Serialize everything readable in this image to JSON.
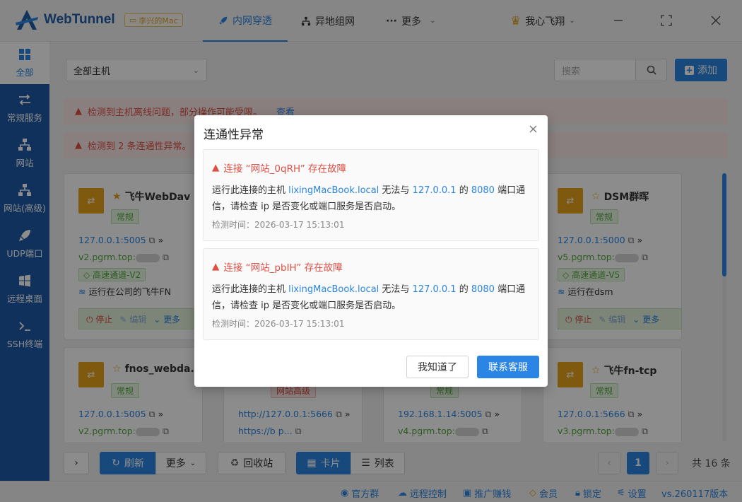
{
  "app": {
    "name": "WebTunnel",
    "device_badge": "李兴的Mac"
  },
  "nav": {
    "items": [
      {
        "label": "内网穿透",
        "active": true
      },
      {
        "label": "异地组网",
        "active": false
      },
      {
        "label": "更多",
        "active": false
      }
    ],
    "user": "我心飞翔"
  },
  "sidebar": {
    "items": [
      {
        "label": "全部",
        "active": true
      },
      {
        "label": "常规服务"
      },
      {
        "label": "网站"
      },
      {
        "label": "网站(高级)"
      },
      {
        "label": "UDP端口"
      },
      {
        "label": "远程桌面"
      },
      {
        "label": "SSH终端"
      }
    ]
  },
  "toolbar": {
    "host_select": "全部主机",
    "search_placeholder": "搜索",
    "add_label": "添加"
  },
  "alerts": [
    {
      "text": "检测到主机离线问题，部分操作可能受限。",
      "link": "查看"
    },
    {
      "text": "检测到 2 条连通性异常。"
    }
  ],
  "cards": [
    {
      "name": "飞牛WebDav",
      "starred": true,
      "tag": "常规",
      "local": "127.0.0.1:5005",
      "domain": "v2.pgrm.top:",
      "channel": "高速通道-V2",
      "runs_on": "运行在公司的飞牛FN",
      "stop": "停止",
      "edit": "编辑",
      "more": "更多"
    },
    {
      "name": "DSM群晖",
      "starred": false,
      "tag": "常规",
      "local": "127.0.0.1:5000",
      "domain": "v5.pgrm.top:",
      "channel": "高速通道-V5",
      "runs_on": "运行在dsm",
      "stop": "停止",
      "edit": "编辑",
      "more": "更多"
    },
    {
      "name": "fnos_webda...",
      "starred": false,
      "tag": "常规",
      "local": "127.0.0.1:5005",
      "domain": "v2.pgrm.top:"
    },
    {
      "name": "",
      "tag": "网站高级",
      "local": "http://127.0.0.1:5666",
      "domain": "https://b         p..."
    },
    {
      "name": "",
      "tag": "常规",
      "local": "192.168.1.14:5005",
      "domain": "v4.pgrm.top:"
    },
    {
      "name": "飞牛fn-tcp",
      "starred": false,
      "tag": "常规",
      "local": "127.0.0.1:5666",
      "domain": "v3.pgrm.top:"
    }
  ],
  "footer": {
    "refresh": "刷新",
    "more": "更多",
    "recycle": "回收站",
    "card_view": "卡片",
    "list_view": "列表",
    "page": "1",
    "total": "共 16 条"
  },
  "statusbar": {
    "items": [
      "官方群",
      "远程控制",
      "推广赚钱",
      "会员",
      "锁定",
      "设置"
    ],
    "version": "vs.260117版本"
  },
  "modal": {
    "title": "连通性异常",
    "issues": [
      {
        "title": "连接 “网站_0qRH” 存在故障",
        "pre": "运行此连接的主机 ",
        "host": "lixingMacBook.local",
        "mid1": " 无法与 ",
        "ip": "127.0.0.1",
        "mid2": " 的 ",
        "port": "8080",
        "post": " 端口通信，请检查 ip 是否变化或端口服务是否启动。",
        "time": "检测时间：2026-03-17 15:13:01"
      },
      {
        "title": "连接 “网站_pbIH” 存在故障",
        "pre": "运行此连接的主机 ",
        "host": "lixingMacBook.local",
        "mid1": " 无法与 ",
        "ip": "127.0.0.1",
        "mid2": " 的 ",
        "port": "8080",
        "post": " 端口通信，请检查 ip 是否变化或端口服务是否启动。",
        "time": "检测时间：2026-03-17 15:13:01"
      }
    ],
    "ok_label": "我知道了",
    "contact_label": "联系客服"
  },
  "colors": {
    "primary": "#2b85e4",
    "sidebar": "#1c5aa6",
    "danger": "#e04f44",
    "success": "#52a83c",
    "warning": "#e8a21a"
  }
}
